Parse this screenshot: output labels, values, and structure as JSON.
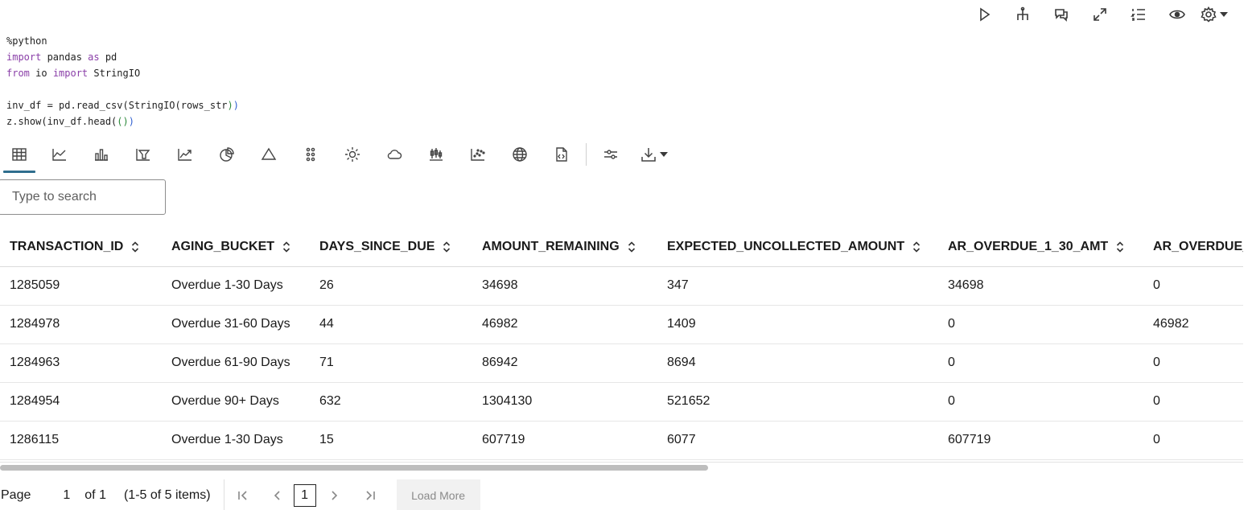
{
  "top_toolbar": {
    "icons": [
      "run-icon",
      "hierarchy-icon",
      "comments-icon",
      "expand-icon",
      "numbered-list-icon",
      "eye-icon",
      "gear-icon"
    ]
  },
  "code": {
    "line1": "%python",
    "line2_kw": "import",
    "line2_rest": " pandas ",
    "line2_kw2": "as",
    "line2_end": " pd",
    "line3_kw": "from",
    "line3_mid": " io ",
    "line3_kw2": "import",
    "line3_end": " StringIO",
    "line5_a": "inv_df = pd.read_csv(StringIO(rows_str",
    "line5_b": ")",
    "line5_c": ")",
    "line6_a": "z.show(inv_df.head(",
    "line6_b": "()",
    "line6_c": ")"
  },
  "viz_toolbar": {
    "icons": [
      "table-icon",
      "line-chart-icon",
      "bar-chart-icon",
      "funnel-chart-icon",
      "trend-chart-icon",
      "pie-chart-icon",
      "triangle-chart-icon",
      "dots-grid-icon",
      "sun-icon",
      "cloud-icon",
      "boxplot-icon",
      "scatter-icon",
      "globe-icon",
      "code-file-icon",
      "settings-sliders-icon",
      "download-icon"
    ]
  },
  "search": {
    "placeholder": "Type to search"
  },
  "table": {
    "headers": [
      "TRANSACTION_ID",
      "AGING_BUCKET",
      "DAYS_SINCE_DUE",
      "AMOUNT_REMAINING",
      "EXPECTED_UNCOLLECTED_AMOUNT",
      "AR_OVERDUE_1_30_AMT",
      "AR_OVERDUE_"
    ],
    "rows": [
      [
        "1285059",
        "Overdue 1-30 Days",
        "26",
        "34698",
        "347",
        "34698",
        "0"
      ],
      [
        "1284978",
        "Overdue 31-60 Days",
        "44",
        "46982",
        "1409",
        "0",
        "46982"
      ],
      [
        "1284963",
        "Overdue 61-90 Days",
        "71",
        "86942",
        "8694",
        "0",
        "0"
      ],
      [
        "1284954",
        "Overdue 90+ Days",
        "632",
        "1304130",
        "521652",
        "0",
        "0"
      ],
      [
        "1286115",
        "Overdue 1-30 Days",
        "15",
        "607719",
        "6077",
        "607719",
        "0"
      ]
    ]
  },
  "pager": {
    "page_label": "Page",
    "page_value": "1",
    "of_label": "of 1",
    "items_label": "(1-5 of 5 items)",
    "current": "1",
    "load_more": "Load More"
  }
}
